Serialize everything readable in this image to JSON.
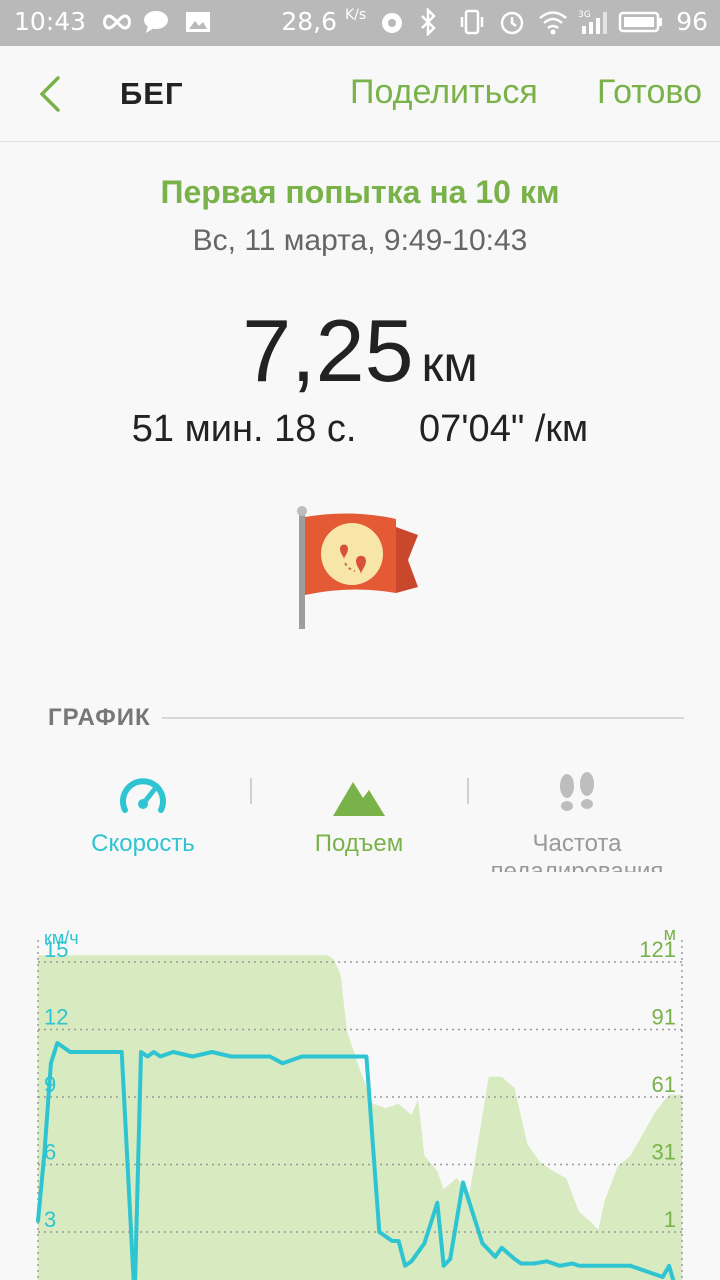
{
  "status_bar": {
    "time": "10:43",
    "network_speed": "28,6",
    "network_unit": "K/s",
    "battery": "96",
    "signal": "3G"
  },
  "header": {
    "title": "БЕГ",
    "share_label": "Поделиться",
    "done_label": "Готово"
  },
  "workout": {
    "name": "Первая попытка на 10 км",
    "date": "Вс, 11 марта, 9:49-10:43",
    "distance": "7,25",
    "distance_unit": "км",
    "duration": "51 мин. 18 с.",
    "pace": "07'04\" /км"
  },
  "graph": {
    "section_label": "ГРАФИК",
    "tabs": [
      {
        "label": "Скорость",
        "icon": "speedometer-icon",
        "color": "#2ec4d2"
      },
      {
        "label": "Подъем",
        "icon": "mountain-icon",
        "color": "#7ab24a"
      },
      {
        "label": "Частота педалирования",
        "icon": "footsteps-icon",
        "color": "#999999"
      }
    ]
  },
  "colors": {
    "accent_green": "#7ab24a",
    "speed_line": "#2ec4d2",
    "elevation_fill": "#d7eac0",
    "flag_red": "#e35a35"
  },
  "chart_data": {
    "type": "line",
    "left_axis": {
      "unit": "км/ч",
      "ticks": [
        3,
        6,
        9,
        12,
        15
      ]
    },
    "right_axis": {
      "unit": "м",
      "ticks": [
        1,
        31,
        61,
        91,
        121
      ]
    },
    "grid": true,
    "series": [
      {
        "axis": "left",
        "style": "line",
        "x": [
          0,
          1,
          2,
          3,
          5,
          7,
          10,
          13,
          15,
          16,
          17,
          18,
          19,
          21,
          24,
          27,
          30,
          33,
          36,
          38,
          41,
          44,
          48,
          51,
          53,
          55,
          56,
          57,
          58,
          60,
          62,
          63,
          64,
          66,
          69,
          71,
          72,
          74,
          75,
          77,
          79,
          81,
          83,
          84,
          86,
          88,
          90,
          92,
          95,
          97,
          98,
          99,
          100
        ],
        "values": [
          3.5,
          6.5,
          10.5,
          11.4,
          11,
          11,
          11,
          11,
          0,
          11,
          10.8,
          11,
          10.8,
          11,
          10.8,
          11,
          10.8,
          10.8,
          10.8,
          10.5,
          10.8,
          10.8,
          10.8,
          10.8,
          3,
          2.6,
          2.6,
          1.5,
          1.7,
          2.5,
          4.3,
          1.5,
          1.8,
          5.2,
          2.5,
          1.9,
          2.3,
          1.8,
          1.6,
          1.6,
          1.7,
          1.5,
          1.6,
          1.5,
          1.5,
          1.5,
          1.5,
          1.5,
          1.2,
          1.0,
          1.5,
          0.5,
          0
        ]
      },
      {
        "axis": "right",
        "style": "area",
        "x": [
          0,
          44,
          45,
          46,
          47,
          48,
          50,
          52,
          54,
          56,
          58,
          59,
          60,
          62,
          63,
          65,
          67,
          70,
          72,
          74,
          76,
          78,
          80,
          82,
          84,
          86,
          87,
          88,
          90,
          92,
          94,
          96,
          98,
          100
        ],
        "values": [
          124,
          124,
          124,
          122,
          115,
          90,
          73,
          58,
          56,
          58,
          53,
          60,
          35,
          28,
          20,
          25,
          18,
          70,
          70,
          65,
          40,
          32,
          28,
          25,
          10,
          5,
          2,
          15,
          30,
          35,
          45,
          55,
          62,
          62
        ]
      }
    ]
  }
}
